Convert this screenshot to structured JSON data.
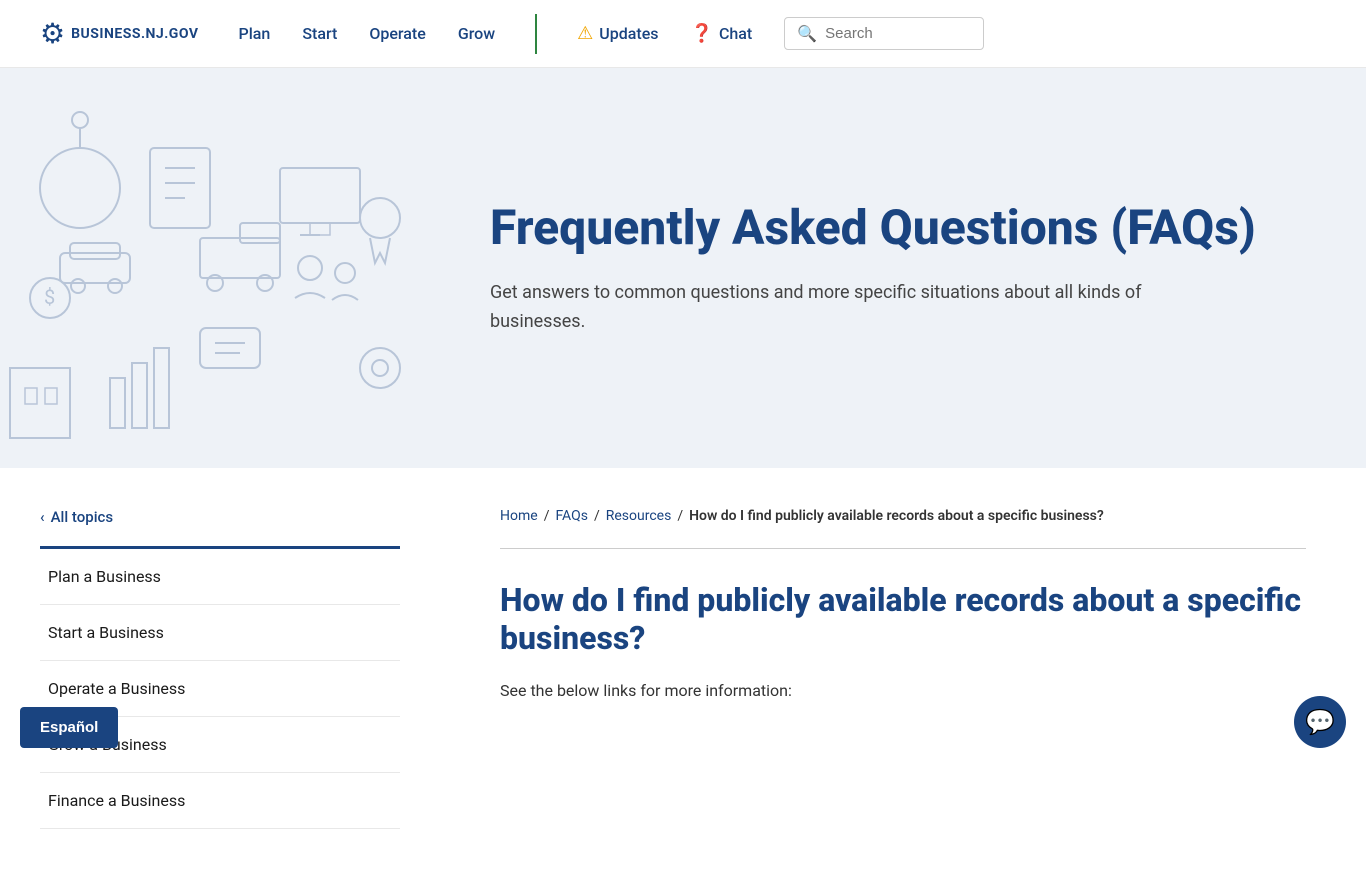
{
  "header": {
    "logo_text": "BUSINESS.NJ.GOV",
    "nav": [
      {
        "label": "Plan",
        "id": "plan"
      },
      {
        "label": "Start",
        "id": "start"
      },
      {
        "label": "Operate",
        "id": "operate"
      },
      {
        "label": "Grow",
        "id": "grow"
      }
    ],
    "updates_label": "Updates",
    "chat_label": "Chat",
    "search_placeholder": "Search"
  },
  "hero": {
    "title": "Frequently Asked Questions (FAQs)",
    "description": "Get answers to common questions and more specific situations about all kinds of businesses."
  },
  "sidebar": {
    "back_label": "All topics",
    "nav_items": [
      {
        "label": "Plan a Business",
        "id": "plan-a-business"
      },
      {
        "label": "Start a Business",
        "id": "start-a-business"
      },
      {
        "label": "Operate a Business",
        "id": "operate-a-business"
      },
      {
        "label": "Grow a Business",
        "id": "grow-a-business"
      },
      {
        "label": "Finance a Business",
        "id": "finance-a-business"
      }
    ]
  },
  "breadcrumb": {
    "home": "Home",
    "faqs": "FAQs",
    "resources": "Resources",
    "current": "How do I find publicly available records about a specific business?"
  },
  "article": {
    "title": "How do I find publicly available records about a specific business?",
    "body": "See the below links for more information:"
  },
  "footer": {
    "espanol_label": "Español"
  }
}
